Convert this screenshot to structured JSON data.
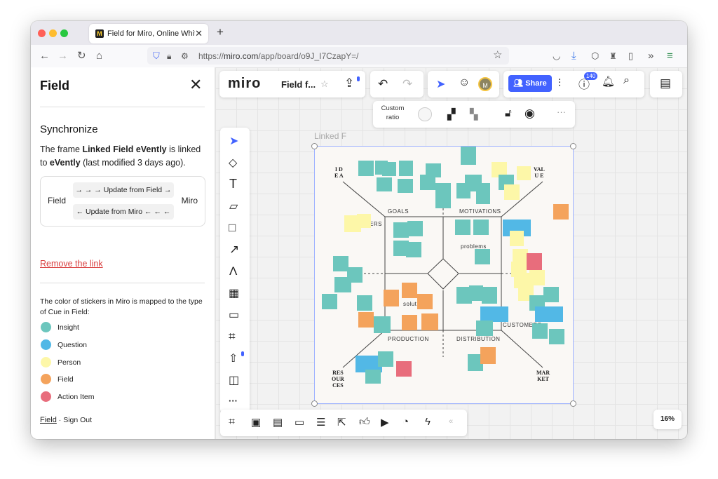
{
  "browser": {
    "tab_title": "Field for Miro, Online Whiteboard",
    "url_prefix": "https://",
    "url_host": "miro.com",
    "url_path": "/app/board/o9J_I7CzapY=/"
  },
  "sidebar": {
    "title": "Field",
    "sync_title": "Synchronize",
    "sync_desc_1": "The frame ",
    "frame_name": "Linked Field eVently",
    "sync_desc_2": " is linked to ",
    "target_name": "eVently",
    "sync_desc_3": " (last modified 3 days ago).",
    "left_label": "Field",
    "right_label": "Miro",
    "update_from_field": "→ → → Update from Field →",
    "update_from_miro": "← Update from Miro ← ← ←",
    "remove_link": "Remove the link",
    "legend_desc": "The color of stickers in Miro is mapped to the type of Cue in Field:",
    "legend": [
      {
        "label": "Insight",
        "color": "#6cc6bd"
      },
      {
        "label": "Question",
        "color": "#52b8e6"
      },
      {
        "label": "Person",
        "color": "#fdf7a8"
      },
      {
        "label": "Field",
        "color": "#f4a35c"
      },
      {
        "label": "Action Item",
        "color": "#e86d7c"
      }
    ],
    "footer_link": "Field",
    "footer_sep": " · ",
    "footer_signout": "Sign Out"
  },
  "miro": {
    "logo": "miro",
    "board_title": "Field f...",
    "share_label": "Share",
    "notifications_count": "140",
    "avatar_letter": "M",
    "custom_ratio": "Custom ratio",
    "frame_label": "Linked F",
    "zoom": "16%"
  },
  "board": {
    "zones": {
      "goals": "GOALS",
      "motivations": "MOTIVATIONS",
      "production": "PRODUCTION",
      "distribution": "DISTRIBUTION",
      "customers": "CUSTOMERS",
      "problems": "problems",
      "solutions": "solut",
      "users": "ERS"
    },
    "corners": {
      "ideas": "I D\nE A",
      "value": "VAL\nU E",
      "resources": "RES\nOUR\nCES",
      "market": "MAR\nKET"
    }
  },
  "colors": {
    "insight": "#6cc6bd",
    "question": "#52b8e6",
    "person": "#fdf7a8",
    "field": "#f4a35c",
    "action": "#e86d7c",
    "brand": "#4262ff"
  }
}
